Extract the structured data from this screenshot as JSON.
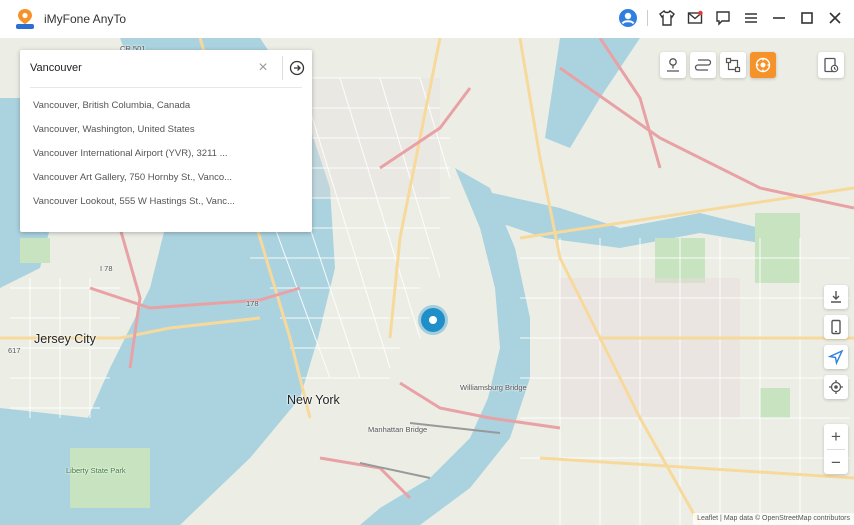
{
  "app": {
    "title": "iMyFone AnyTo",
    "logo_icon": "anyto-pin-logo",
    "accent_color": "#f6922a",
    "pin_color": "#1f8fc9"
  },
  "titlebar_icons": [
    "user-icon",
    "tshirt-icon",
    "mail-icon",
    "chat-icon",
    "menu-icon",
    "minimize-icon",
    "maximize-icon",
    "close-icon"
  ],
  "search": {
    "value": "Vancouver",
    "clear_glyph": "×",
    "suggestions": [
      "Vancouver, British Columbia, Canada",
      "Vancouver, Washington, United States",
      "Vancouver International Airport (YVR), 3211 ...",
      "Vancouver Art Gallery, 750 Hornby St., Vanco...",
      "Vancouver Lookout, 555 W Hastings St., Vanc..."
    ]
  },
  "mode_buttons": [
    {
      "icon": "teleport-icon",
      "active": false
    },
    {
      "icon": "two-spot-route-icon",
      "active": false
    },
    {
      "icon": "multi-spot-route-icon",
      "active": false
    },
    {
      "icon": "joystick-icon",
      "active": true
    }
  ],
  "history_icon": "history-icon",
  "side_tools": [
    "save-icon",
    "device-icon",
    "navigate-icon",
    "locate-icon"
  ],
  "zoom": {
    "in": "+",
    "out": "−"
  },
  "map_labels": {
    "jersey_city": "Jersey City",
    "new_york": "New York",
    "cr501": "CR 501",
    "i78": "I 78",
    "i78b": "178",
    "hwy617": "617",
    "liberty_park": "Liberty State Park",
    "manhattan_bridge": "Manhattan Bridge",
    "williamsburg_bridge": "Williamsburg Bridge"
  },
  "attribution": "Leaflet | Map data © OpenStreetMap contributors"
}
